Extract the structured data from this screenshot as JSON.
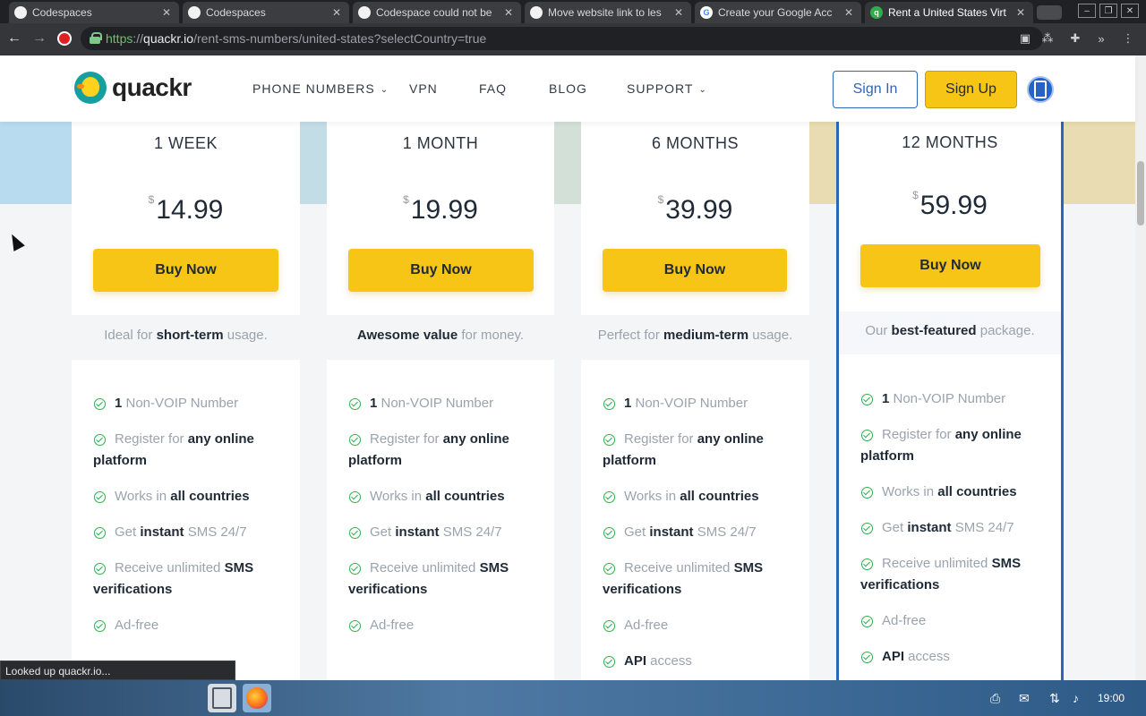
{
  "browser": {
    "tabs": [
      {
        "title": "Codespaces",
        "icon": "github-icon"
      },
      {
        "title": "Codespaces",
        "icon": "github-icon"
      },
      {
        "title": "Codespace could not be",
        "icon": "github-icon"
      },
      {
        "title": "Move website link to les",
        "icon": "github-icon"
      },
      {
        "title": "Create your Google Acc",
        "icon": "google-icon"
      },
      {
        "title": "Rent a United States Virt",
        "icon": "quackr-icon",
        "active": true
      }
    ],
    "url": {
      "scheme": "https",
      "sep": "://",
      "host": "quackr.io",
      "path": "/rent-sms-numbers/united-states?selectCountry=true"
    },
    "status_text": "Looked up quackr.io..."
  },
  "site": {
    "logo_text": "quackr",
    "nav": [
      {
        "label": "PHONE NUMBERS",
        "has_dropdown": true
      },
      {
        "label": "VPN",
        "has_dropdown": false
      },
      {
        "label": "FAQ",
        "has_dropdown": false
      },
      {
        "label": "BLOG",
        "has_dropdown": false
      },
      {
        "label": "SUPPORT",
        "has_dropdown": true
      }
    ],
    "sign_in": "Sign In",
    "sign_up": "Sign Up"
  },
  "plans": [
    {
      "name": "1 WEEK",
      "currency": "$",
      "price": "14.99",
      "buy": "Buy Now",
      "tagline": {
        "pre": "Ideal for ",
        "bold": "short-term",
        "post": " usage."
      },
      "features": [
        {
          "pre": "",
          "bold": "1",
          "post": " Non-VOIP Number"
        },
        {
          "pre": "Register for ",
          "bold": "any online platform",
          "post": ""
        },
        {
          "pre": "Works in ",
          "bold": "all countries",
          "post": ""
        },
        {
          "pre": "Get ",
          "bold": "instant",
          "post": " SMS 24/7"
        },
        {
          "pre": "Receive unlimited ",
          "bold": "SMS verifications",
          "post": ""
        },
        {
          "pre": "Ad-free",
          "bold": "",
          "post": ""
        }
      ]
    },
    {
      "name": "1 MONTH",
      "currency": "$",
      "price": "19.99",
      "buy": "Buy Now",
      "tagline": {
        "pre": "",
        "bold": "Awesome value",
        "post": " for money."
      },
      "features": [
        {
          "pre": "",
          "bold": "1",
          "post": " Non-VOIP Number"
        },
        {
          "pre": "Register for ",
          "bold": "any online platform",
          "post": ""
        },
        {
          "pre": "Works in ",
          "bold": "all countries",
          "post": ""
        },
        {
          "pre": "Get ",
          "bold": "instant",
          "post": " SMS 24/7"
        },
        {
          "pre": "Receive unlimited ",
          "bold": "SMS verifications",
          "post": ""
        },
        {
          "pre": "Ad-free",
          "bold": "",
          "post": ""
        }
      ]
    },
    {
      "name": "6 MONTHS",
      "currency": "$",
      "price": "39.99",
      "buy": "Buy Now",
      "tagline": {
        "pre": "Perfect for ",
        "bold": "medium-term",
        "post": " usage."
      },
      "features": [
        {
          "pre": "",
          "bold": "1",
          "post": " Non-VOIP Number"
        },
        {
          "pre": "Register for ",
          "bold": "any online platform",
          "post": ""
        },
        {
          "pre": "Works in ",
          "bold": "all countries",
          "post": ""
        },
        {
          "pre": "Get ",
          "bold": "instant",
          "post": " SMS 24/7"
        },
        {
          "pre": "Receive unlimited ",
          "bold": "SMS verifications",
          "post": ""
        },
        {
          "pre": "Ad-free",
          "bold": "",
          "post": ""
        },
        {
          "pre": "",
          "bold": "API",
          "post": " access"
        }
      ]
    },
    {
      "name": "12 MONTHS",
      "currency": "$",
      "price": "59.99",
      "buy": "Buy Now",
      "featured": true,
      "tagline": {
        "pre": "Our ",
        "bold": "best-featured",
        "post": " package."
      },
      "features": [
        {
          "pre": "",
          "bold": "1",
          "post": " Non-VOIP Number"
        },
        {
          "pre": "Register for ",
          "bold": "any online platform",
          "post": ""
        },
        {
          "pre": "Works in ",
          "bold": "all countries",
          "post": ""
        },
        {
          "pre": "Get ",
          "bold": "instant",
          "post": " SMS 24/7"
        },
        {
          "pre": "Receive unlimited ",
          "bold": "SMS verifications",
          "post": ""
        },
        {
          "pre": "Ad-free",
          "bold": "",
          "post": ""
        },
        {
          "pre": "",
          "bold": "API",
          "post": " access"
        }
      ]
    }
  ],
  "taskbar": {
    "clock": "19:00",
    "apps": [
      "file-manager-icon",
      "firefox-icon"
    ]
  },
  "colors": {
    "accent_yellow": "#f6c515",
    "brand_blue": "#2b66b8",
    "check_green": "#2bb04c",
    "band_colors": [
      "#b9dbef",
      "#c3dde6",
      "#d2e0d8",
      "#e9dcb2"
    ]
  }
}
